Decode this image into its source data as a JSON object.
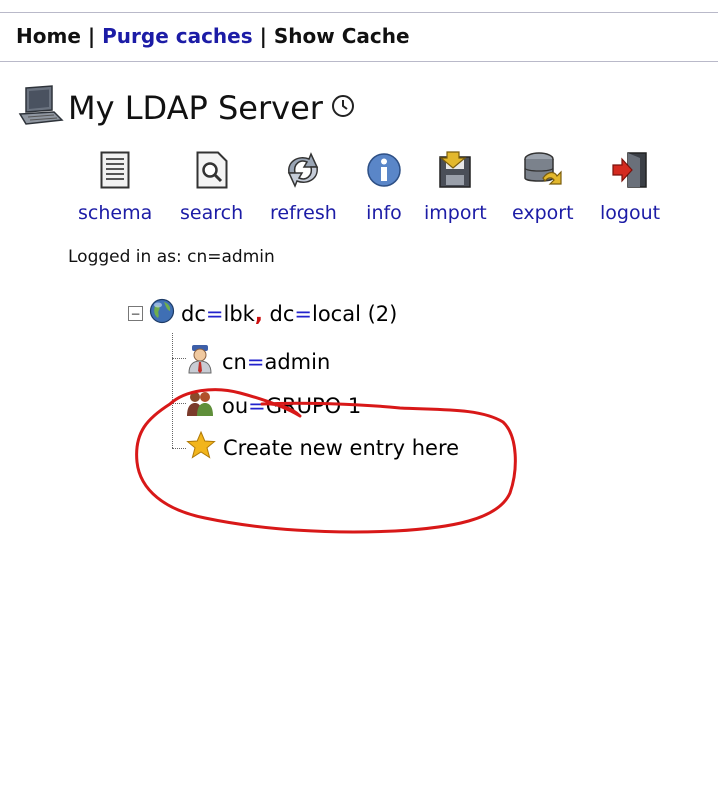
{
  "nav": {
    "home": "Home",
    "sep1": " | ",
    "purge_caches": "Purge caches",
    "sep2": " | ",
    "show_cache": "Show Cache"
  },
  "server": {
    "title": "My LDAP Server"
  },
  "toolbar": {
    "schema": "schema",
    "search": "search",
    "refresh": "refresh",
    "info": "info",
    "import": "import",
    "export": "export",
    "logout": "logout"
  },
  "session": {
    "logged_in": "Logged in as: cn=admin"
  },
  "tree": {
    "root": {
      "a_key": "dc",
      "a_eq": "=",
      "a_val": "lbk",
      "comma": ",",
      "b_key": " dc",
      "b_eq": "=",
      "b_val": "local",
      "count": " (2)"
    },
    "child1": {
      "key": "cn",
      "eq": "=",
      "val": "admin"
    },
    "child2": {
      "key": "ou",
      "eq": "=",
      "val": "GRUPO 1"
    },
    "create": "Create new entry here"
  },
  "colors": {
    "link": "#1c1ca6",
    "annotation": "#d81818"
  }
}
